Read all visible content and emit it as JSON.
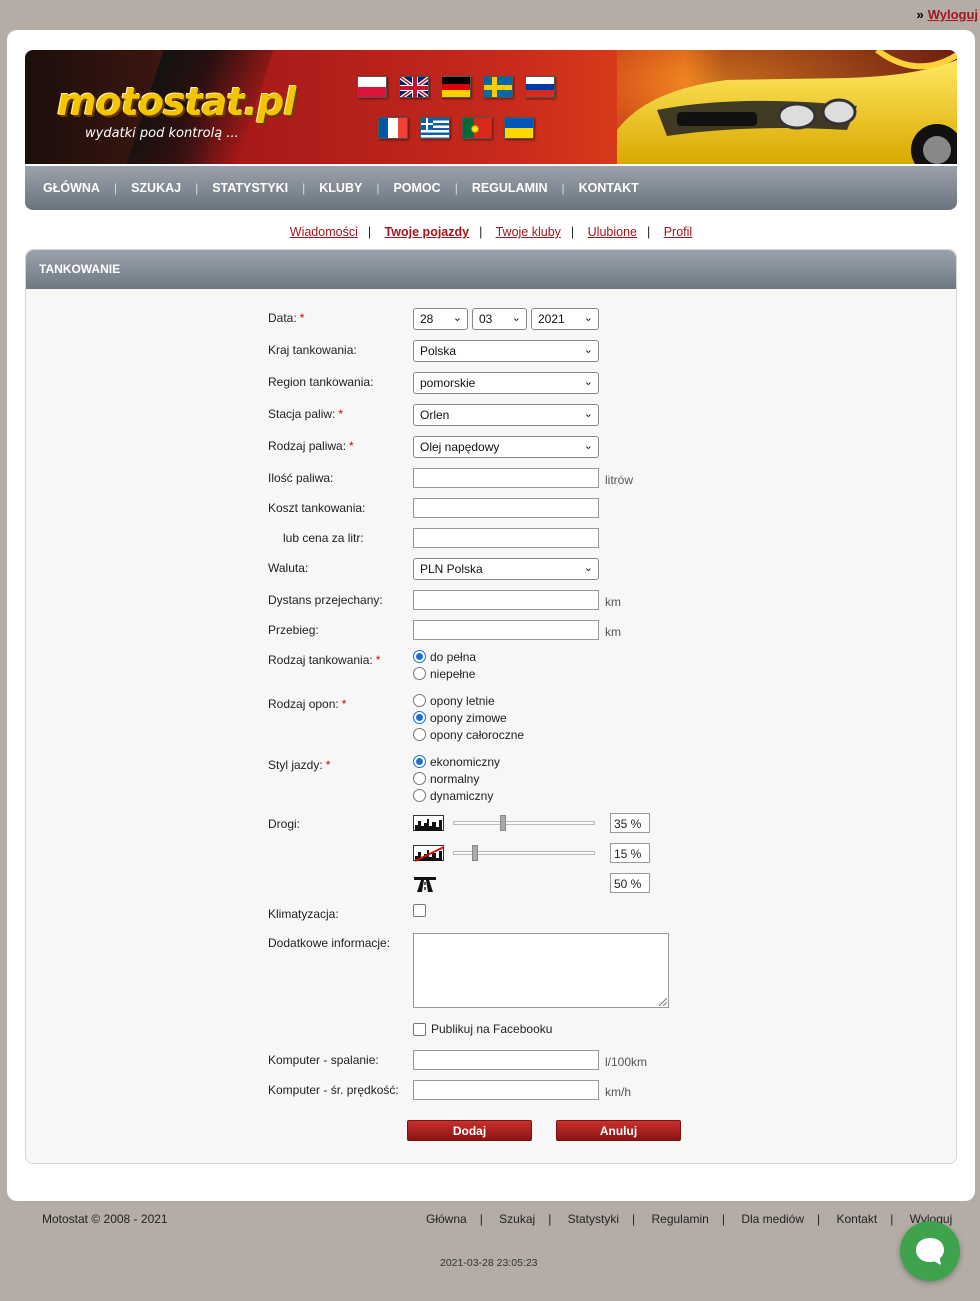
{
  "top": {
    "raquo": "»",
    "logout": "Wyloguj"
  },
  "header": {
    "logo": "motostat.pl",
    "tagline": "wydatki pod kontrolą ..."
  },
  "flags": [
    {
      "name": "pl-flag"
    },
    {
      "name": "uk-flag"
    },
    {
      "name": "de-flag"
    },
    {
      "name": "se-flag"
    },
    {
      "name": "ru-flag"
    },
    {
      "name": "fr-flag"
    },
    {
      "name": "gr-flag"
    },
    {
      "name": "pt-flag"
    },
    {
      "name": "ua-flag"
    }
  ],
  "nav": {
    "items": [
      "GŁÓWNA",
      "SZUKAJ",
      "STATYSTYKI",
      "KLUBY",
      "POMOC",
      "REGULAMIN",
      "KONTAKT"
    ]
  },
  "subnav": {
    "items": [
      "Wiadomości",
      "Twoje pojazdy",
      "Twoje kluby",
      "Ulubione",
      "Profil"
    ],
    "active": "Twoje pojazdy",
    "sep": "|"
  },
  "panel": {
    "title": "TANKOWANIE"
  },
  "form": {
    "required_mark": "*",
    "date": {
      "label": "Data:",
      "day": "28",
      "month": "03",
      "year": "2021"
    },
    "country": {
      "label": "Kraj tankowania:",
      "value": "Polska"
    },
    "region": {
      "label": "Region tankowania:",
      "value": "pomorskie"
    },
    "station": {
      "label": "Stacja paliw:",
      "value": "Orlen"
    },
    "fuel": {
      "label": "Rodzaj paliwa:",
      "value": "Olej napędowy"
    },
    "amount": {
      "label": "Ilość paliwa:",
      "unit": "litrów"
    },
    "cost": {
      "label": "Koszt tankowania:"
    },
    "price": {
      "label": "lub cena za litr:"
    },
    "currency": {
      "label": "Waluta:",
      "value": "PLN Polska"
    },
    "distance": {
      "label": "Dystans przejechany:",
      "unit": "km"
    },
    "odometer": {
      "label": "Przebieg:",
      "unit": "km"
    },
    "fill_type": {
      "label": "Rodzaj tankowania:",
      "options": [
        "do pełna",
        "niepełne"
      ],
      "selected": 0
    },
    "tires": {
      "label": "Rodzaj opon:",
      "options": [
        "opony letnie",
        "opony zimowe",
        "opony całoroczne"
      ],
      "selected": 1
    },
    "style": {
      "label": "Styl jazdy:",
      "options": [
        "ekonomiczny",
        "normalny",
        "dynamiczny"
      ],
      "selected": 0
    },
    "roads": {
      "label": "Drogi:",
      "city_pct": "35 %",
      "country_pct": "15 %",
      "highway_pct": "50 %",
      "city_value": 35,
      "country_value": 15,
      "highway_value": 50,
      "icons": [
        "city-road-icon",
        "country-road-icon",
        "highway-icon"
      ]
    },
    "ac": {
      "label": "Klimatyzacja:",
      "checked": false
    },
    "notes": {
      "label": "Dodatkowe informacje:"
    },
    "facebook": {
      "label": "Publikuj na Facebooku",
      "checked": false
    },
    "computer_consumption": {
      "label": "Komputer - spalanie:",
      "unit": "l/100km"
    },
    "computer_speed": {
      "label": "Komputer - śr. prędkość:",
      "unit": "km/h"
    },
    "add_btn": "Dodaj",
    "cancel_btn": "Anuluj"
  },
  "footer": {
    "copyright": "Motostat © 2008 - 2021",
    "links": [
      "Główna",
      "Szukaj",
      "Statystyki",
      "Regulamin",
      "Dla mediów",
      "Kontakt",
      "Wyloguj"
    ],
    "timestamp": "2021-03-28 23:05:23"
  },
  "colors": {
    "brand_red": "#a3151b",
    "nav_gray": "#7d8792",
    "radio_blue": "#1a6fd1",
    "chat_green": "#3fa34d"
  }
}
